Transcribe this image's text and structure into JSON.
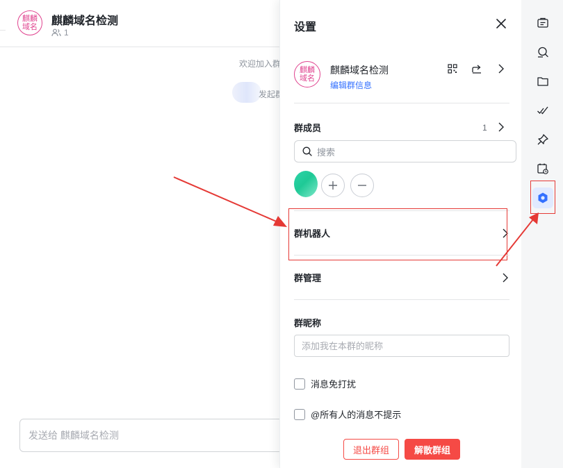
{
  "chat": {
    "title": "麒麟域名检测",
    "avatar_text": "麒麟域名",
    "member_count": "1",
    "welcome_text": "欢迎加入群",
    "system_text": "发起群",
    "input_placeholder": "发送给 麒麟域名检测"
  },
  "settings": {
    "title": "设置",
    "group_name": "麒麟域名检测",
    "group_avatar_text": "麒麟域名",
    "edit_group_info": "编辑群信息",
    "members_label": "群成员",
    "members_count": "1",
    "search_placeholder": "搜索",
    "group_bot_label": "群机器人",
    "group_manage_label": "群管理",
    "nickname_label": "群昵称",
    "nickname_placeholder": "添加我在本群的昵称",
    "mute_label": "消息免打扰",
    "at_all_label": "@所有人的消息不提示",
    "leave_button": "退出群组",
    "disband_button": "解散群组"
  },
  "toolbar": {
    "items": [
      "announcement-icon",
      "search-chat-icon",
      "folder-icon",
      "tasks-icon",
      "pin-icon",
      "calendar-icon",
      "settings-icon"
    ],
    "active": "settings-icon"
  },
  "colors": {
    "accent_blue": "#3370ff",
    "danger_red": "#f54a45",
    "annotation_red": "#e53935",
    "avatar_pink": "#e0438f",
    "member_green": "#1fc996"
  }
}
